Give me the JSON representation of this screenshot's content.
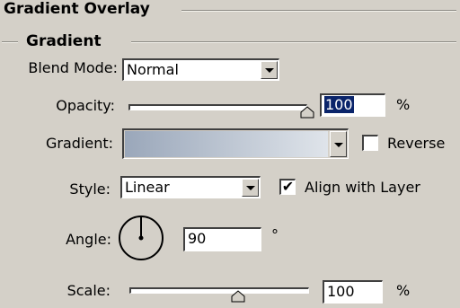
{
  "panel": {
    "title": "Gradient Overlay",
    "section": "Gradient"
  },
  "blend_mode": {
    "label": "Blend Mode:",
    "value": "Normal"
  },
  "opacity": {
    "label": "Opacity:",
    "value": "100",
    "unit": "%",
    "slider_fraction": 1.0
  },
  "gradient": {
    "label": "Gradient:",
    "colors": [
      "#9aa7ba",
      "#dfe4ea"
    ]
  },
  "reverse": {
    "label": "Reverse",
    "checked": false
  },
  "style": {
    "label": "Style:",
    "value": "Linear"
  },
  "align_with_layer": {
    "label": "Align with Layer",
    "checked": true,
    "mark": "✔"
  },
  "angle": {
    "label": "Angle:",
    "value": "90",
    "unit": "°"
  },
  "scale": {
    "label": "Scale:",
    "value": "100",
    "unit": "%",
    "slider_fraction": 0.5
  }
}
